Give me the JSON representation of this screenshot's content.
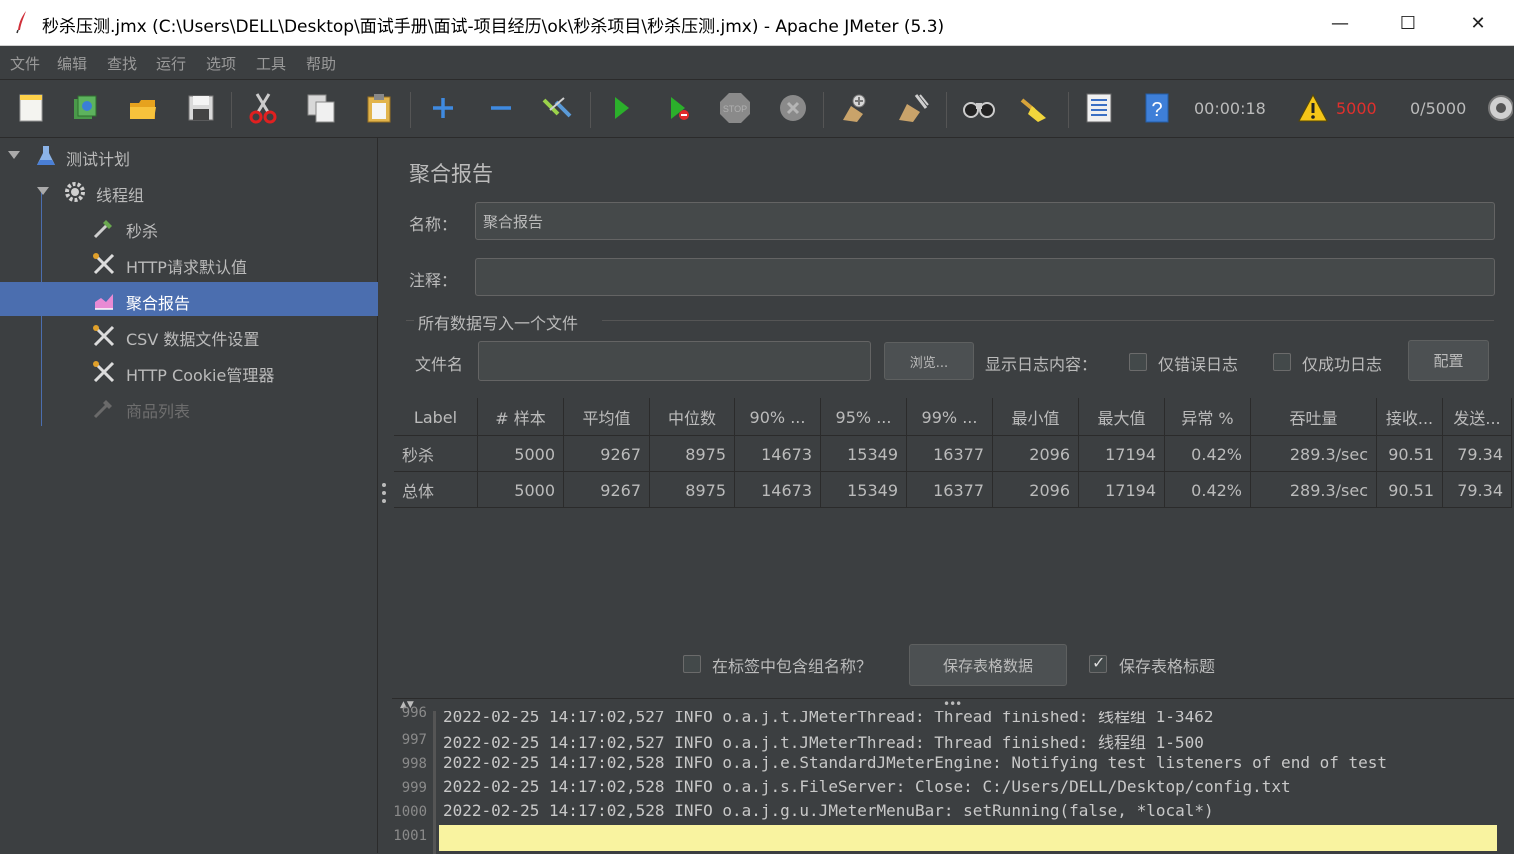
{
  "window": {
    "title": "秒杀压测.jmx (C:\\Users\\DELL\\Desktop\\面试手册\\面试-项目经历\\ok\\秒杀项目\\秒杀压测.jmx) - Apache JMeter (5.3)",
    "minimize": "—",
    "maximize": "☐",
    "close": "✕"
  },
  "menu": [
    "文件",
    "编辑",
    "查找",
    "运行",
    "选项",
    "工具",
    "帮助"
  ],
  "toolbar": {
    "timer": "00:00:18",
    "errors": "5000",
    "threads": "0/5000",
    "error_color": "#e0302d"
  },
  "tree": {
    "items": [
      {
        "label": "测试计划"
      },
      {
        "label": "线程组"
      },
      {
        "label": "秒杀"
      },
      {
        "label": "HTTP请求默认值"
      },
      {
        "label": "聚合报告"
      },
      {
        "label": "CSV 数据文件设置"
      },
      {
        "label": "HTTP Cookie管理器"
      },
      {
        "label": "商品列表"
      }
    ]
  },
  "panel": {
    "title": "聚合报告",
    "name_label": "名称：",
    "name_value": "聚合报告",
    "comment_label": "注释：",
    "comment_value": "",
    "group_title": "所有数据写入一个文件",
    "file_label": "文件名",
    "file_value": "",
    "browse": "浏览...",
    "log_content_label": "显示日志内容：",
    "errors_only": "仅错误日志",
    "success_only": "仅成功日志",
    "configure": "配置",
    "include_group": "在标签中包含组名称？",
    "save_table": "保存表格数据",
    "save_header": "保存表格标题"
  },
  "table": {
    "headers": [
      "Label",
      "# 样本",
      "平均值",
      "中位数",
      "90% ...",
      "95% ...",
      "99% ...",
      "最小值",
      "最大值",
      "异常 %",
      "吞吐量",
      "接收...",
      "发送..."
    ],
    "rows": [
      [
        "秒杀",
        "5000",
        "9267",
        "8975",
        "14673",
        "15349",
        "16377",
        "2096",
        "17194",
        "0.42%",
        "289.3/sec",
        "90.51",
        "79.34"
      ],
      [
        "总体",
        "5000",
        "9267",
        "8975",
        "14673",
        "15349",
        "16377",
        "2096",
        "17194",
        "0.42%",
        "289.3/sec",
        "90.51",
        "79.34"
      ]
    ]
  },
  "log": {
    "line_numbers": [
      "996",
      "997",
      "998",
      "999",
      "1000",
      "1001"
    ],
    "lines": [
      "2022-02-25 14:17:02,527 INFO o.a.j.t.JMeterThread: Thread finished: 线程组 1-3462",
      "2022-02-25 14:17:02,527 INFO o.a.j.t.JMeterThread: Thread finished: 线程组 1-500",
      "2022-02-25 14:17:02,528 INFO o.a.j.e.StandardJMeterEngine: Notifying test listeners of end of test",
      "2022-02-25 14:17:02,528 INFO o.a.j.s.FileServer: Close: C:/Users/DELL/Desktop/config.txt",
      "2022-02-25 14:17:02,528 INFO o.a.j.g.u.JMeterMenuBar: setRunning(false, *local*)",
      ""
    ]
  }
}
